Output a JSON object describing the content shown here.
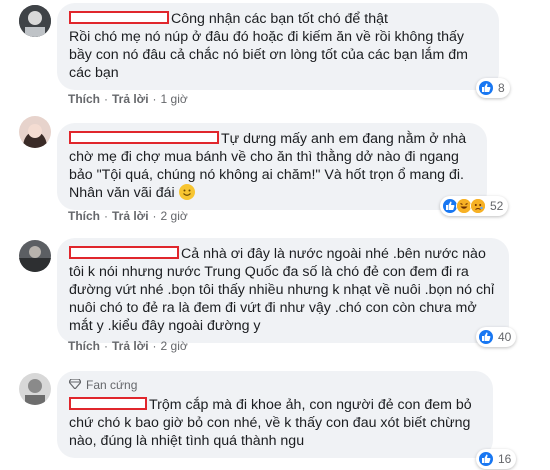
{
  "actions": {
    "like": "Thích",
    "reply": "Trả lời",
    "separator": "·"
  },
  "comments": [
    {
      "text": "Công nhận các bạn tốt chó để thật\nRồi chó mẹ nó núp ở đâu đó hoặc đi kiếm ăn về rồi không thấy bầy con nó đâu cả chắc nó biết ơn lòng tốt của các bạn lắm đm các bạn",
      "time": "1 giờ",
      "reactions": [
        "like"
      ],
      "reaction_count": "8"
    },
    {
      "text": "Tự dưng mấy anh em đang nằm ở nhà chờ mẹ đi chợ mua bánh về cho ăn thì thằng dở nào đi ngang bảo \"Tội quá, chúng nó không ai chăm!\" Và hốt trọn ổ mang đi. Nhân văn vãi đái",
      "time": "2 giờ",
      "reactions": [
        "like",
        "haha",
        "sad"
      ],
      "reaction_count": "52"
    },
    {
      "text": "Cả nhà ơi đây là nước ngoài nhé .bên nước nào tôi k nói nhưng nước Trung Quốc đa số là chó đẻ con đem đi ra đường vứt nhé .bọn tôi thấy nhiều nhưng k nhạt về nuôi .bọn nó chỉ nuôi chó to đẻ ra là đem đi vứt đi như vậy .chó con còn chưa mở mắt y .kiểu đây ngoài đường y",
      "time": "2 giờ",
      "reactions": [
        "like"
      ],
      "reaction_count": "40"
    },
    {
      "badge": "Fan cứng",
      "text": "Trộm cắp mà đi khoe ảh, con người đẻ con đem bỏ chứ chó k bao giờ bỏ con nhé, về k thấy con đau xót biết chừng nào, đúng là nhiệt tình quá thành ngu",
      "time": "2 giờ",
      "reactions": [
        "like"
      ],
      "reaction_count": "16"
    }
  ],
  "colors": {
    "bubble": "#f0f2f5",
    "redaction": "#e0262c",
    "like": "#1877f2",
    "meta": "#65676b"
  }
}
